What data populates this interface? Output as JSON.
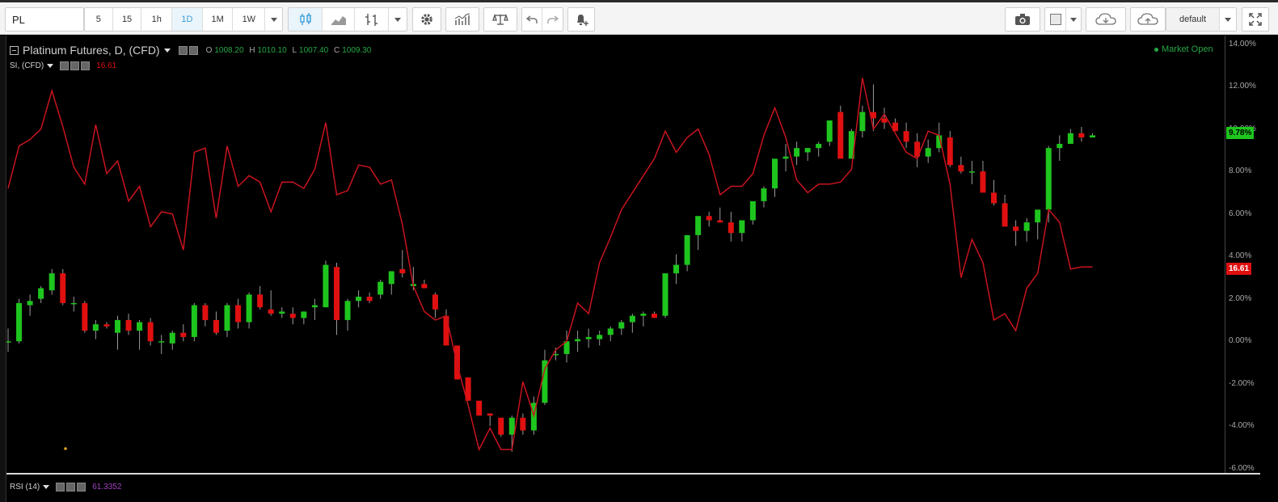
{
  "toolbar": {
    "symbol": "PL",
    "intervals": [
      "5",
      "15",
      "1h",
      "1D",
      "1M",
      "1W"
    ],
    "active_interval": "1D",
    "layout_name": "default",
    "colors": {
      "active": "#3aa0d8",
      "bg": "#f4f4f4"
    }
  },
  "legend": {
    "main_title": "Platinum Futures, D, (CFD)",
    "ohlc": [
      {
        "key": "O",
        "value": "1008.20"
      },
      {
        "key": "H",
        "value": "1010.10"
      },
      {
        "key": "L",
        "value": "1007.40"
      },
      {
        "key": "C",
        "value": "1009.30"
      }
    ],
    "compare_symbol": "SI, (CFD)",
    "compare_value": "16.61",
    "market_status": "Market Open"
  },
  "rsi": {
    "label": "RSI (14)",
    "value": "61.3352"
  },
  "axis": {
    "ticks": [
      "14.00%",
      "12.00%",
      "10.00%",
      "8.00%",
      "6.00%",
      "4.00%",
      "2.00%",
      "0.00%",
      "-2.00%",
      "-4.00%",
      "-6.00%"
    ],
    "tick_values": [
      14,
      12,
      10,
      8,
      6,
      4,
      2,
      0,
      -2,
      -4,
      -6
    ],
    "pl_badge": "9.78%",
    "pl_badge_value": 9.78,
    "si_badge": "16.61",
    "si_badge_value": 3.4
  },
  "chart_data": {
    "type": "candlestick",
    "ylim": [
      -6.2,
      14.4
    ],
    "y_unit": "%",
    "colors": {
      "up": "#1ec51e",
      "down": "#e01010",
      "compare": "#c8141e"
    },
    "series": [
      {
        "name": "PL",
        "kind": "ohlc_percent",
        "ohlc": [
          [
            0.0,
            0.6,
            -0.5,
            0.0
          ],
          [
            0.0,
            2.0,
            -0.1,
            1.8
          ],
          [
            1.7,
            2.2,
            1.2,
            1.9
          ],
          [
            2.0,
            2.6,
            1.8,
            2.5
          ],
          [
            2.4,
            3.4,
            2.2,
            3.2
          ],
          [
            3.2,
            3.4,
            1.7,
            1.8
          ],
          [
            1.8,
            2.1,
            1.4,
            1.8
          ],
          [
            1.8,
            1.9,
            0.4,
            0.5
          ],
          [
            0.5,
            1.0,
            0.1,
            0.8
          ],
          [
            0.8,
            0.9,
            0.6,
            0.7
          ],
          [
            0.4,
            1.2,
            -0.4,
            1.0
          ],
          [
            1.0,
            1.3,
            0.3,
            0.5
          ],
          [
            0.5,
            1.0,
            -0.4,
            0.9
          ],
          [
            0.9,
            1.1,
            -0.2,
            0.0
          ],
          [
            0.0,
            0.3,
            -0.6,
            0.0
          ],
          [
            -0.1,
            0.5,
            -0.4,
            0.4
          ],
          [
            0.4,
            0.8,
            0.0,
            0.2
          ],
          [
            0.2,
            1.8,
            0.0,
            1.7
          ],
          [
            1.7,
            1.8,
            0.7,
            1.0
          ],
          [
            1.0,
            1.4,
            0.3,
            0.4
          ],
          [
            0.5,
            1.8,
            0.2,
            1.7
          ],
          [
            1.7,
            2.0,
            0.6,
            0.9
          ],
          [
            0.9,
            2.3,
            0.6,
            2.2
          ],
          [
            2.2,
            2.6,
            1.5,
            1.6
          ],
          [
            1.5,
            2.4,
            1.2,
            1.3
          ],
          [
            1.3,
            1.6,
            1.1,
            1.4
          ],
          [
            1.3,
            1.6,
            0.8,
            1.1
          ],
          [
            1.1,
            1.4,
            0.8,
            1.4
          ],
          [
            1.6,
            2.0,
            1.0,
            1.7
          ],
          [
            1.6,
            3.8,
            1.6,
            3.6
          ],
          [
            3.5,
            3.7,
            0.3,
            1.0
          ],
          [
            1.0,
            2.0,
            0.5,
            1.9
          ],
          [
            1.9,
            2.4,
            1.6,
            2.1
          ],
          [
            2.1,
            2.3,
            1.8,
            1.9
          ],
          [
            2.2,
            2.9,
            2.0,
            2.8
          ],
          [
            2.7,
            3.1,
            2.2,
            3.3
          ],
          [
            3.4,
            4.3,
            3.0,
            3.2
          ],
          [
            2.6,
            3.5,
            2.4,
            2.7
          ],
          [
            2.7,
            2.9,
            2.5,
            2.5
          ],
          [
            2.2,
            2.3,
            1.1,
            1.5
          ],
          [
            1.2,
            1.5,
            -0.2,
            -0.2
          ],
          [
            -0.2,
            -0.3,
            -1.7,
            -1.8
          ],
          [
            -1.7,
            -2.0,
            -2.8,
            -2.8
          ],
          [
            -2.8,
            -3.3,
            -3.5,
            -3.5
          ],
          [
            -3.4,
            -3.5,
            -4.0,
            -3.5
          ],
          [
            -3.6,
            -4.1,
            -4.5,
            -4.4
          ],
          [
            -4.4,
            -3.5,
            -5.2,
            -3.6
          ],
          [
            -3.6,
            -3.4,
            -4.4,
            -4.2
          ],
          [
            -4.2,
            -2.6,
            -4.4,
            -2.9
          ],
          [
            -2.9,
            -0.4,
            -3.0,
            -0.9
          ],
          [
            -0.6,
            -0.3,
            -0.9,
            -0.6
          ],
          [
            -0.6,
            0.5,
            -1.0,
            0.0
          ],
          [
            0.0,
            0.5,
            -0.5,
            0.1
          ],
          [
            0.1,
            0.6,
            -0.3,
            0.2
          ],
          [
            0.1,
            0.5,
            -0.2,
            0.3
          ],
          [
            0.3,
            0.7,
            0.0,
            0.6
          ],
          [
            0.6,
            1.0,
            0.3,
            0.9
          ],
          [
            0.9,
            1.3,
            0.4,
            1.2
          ],
          [
            1.2,
            1.4,
            0.7,
            1.3
          ],
          [
            1.3,
            1.4,
            1.1,
            1.1
          ],
          [
            1.2,
            3.2,
            1.1,
            3.2
          ],
          [
            3.2,
            4.1,
            2.7,
            3.6
          ],
          [
            3.6,
            5.0,
            3.3,
            5.0
          ],
          [
            5.0,
            5.8,
            4.3,
            5.9
          ],
          [
            5.9,
            6.1,
            5.4,
            5.7
          ],
          [
            5.7,
            6.3,
            5.6,
            5.6
          ],
          [
            5.6,
            6.1,
            4.7,
            5.1
          ],
          [
            5.1,
            5.7,
            4.7,
            5.7
          ],
          [
            5.7,
            6.5,
            5.5,
            6.6
          ],
          [
            6.6,
            7.3,
            6.3,
            7.2
          ],
          [
            7.2,
            8.6,
            6.8,
            8.6
          ],
          [
            8.6,
            9.3,
            8.0,
            8.7
          ],
          [
            8.7,
            9.4,
            8.3,
            9.1
          ],
          [
            8.9,
            9.1,
            8.5,
            9.1
          ],
          [
            9.1,
            9.4,
            8.7,
            9.3
          ],
          [
            9.4,
            10.4,
            9.2,
            10.4
          ],
          [
            10.8,
            11.1,
            9.6,
            8.6
          ],
          [
            8.6,
            10.0,
            8.6,
            9.9
          ],
          [
            9.9,
            11.1,
            9.6,
            10.8
          ],
          [
            10.8,
            12.1,
            9.9,
            10.5
          ],
          [
            10.5,
            11.0,
            10.0,
            10.3
          ],
          [
            10.3,
            10.5,
            9.9,
            9.9
          ],
          [
            9.9,
            10.3,
            9.1,
            9.4
          ],
          [
            9.4,
            9.8,
            8.2,
            8.7
          ],
          [
            8.7,
            9.5,
            8.4,
            9.1
          ],
          [
            9.1,
            10.3,
            8.9,
            9.7
          ],
          [
            9.6,
            9.9,
            8.2,
            8.3
          ],
          [
            8.3,
            8.7,
            7.9,
            8.0
          ],
          [
            8.0,
            8.5,
            7.4,
            8.0
          ],
          [
            8.0,
            8.5,
            7.5,
            7.0
          ],
          [
            7.0,
            7.6,
            6.4,
            6.5
          ],
          [
            6.5,
            6.9,
            5.7,
            5.4
          ],
          [
            5.4,
            5.7,
            4.5,
            5.2
          ],
          [
            5.2,
            5.8,
            4.7,
            5.6
          ],
          [
            5.6,
            6.1,
            4.8,
            6.2
          ],
          [
            6.2,
            9.2,
            5.6,
            9.1
          ],
          [
            9.1,
            9.7,
            8.5,
            9.3
          ],
          [
            9.3,
            10.0,
            9.3,
            9.8
          ],
          [
            9.8,
            10.1,
            9.4,
            9.6
          ],
          [
            9.6,
            9.8,
            9.6,
            9.7
          ]
        ]
      },
      {
        "name": "SI",
        "kind": "line_percent",
        "values": [
          7.2,
          9.2,
          9.5,
          10.0,
          11.8,
          10.1,
          8.2,
          7.4,
          10.2,
          7.9,
          8.5,
          6.6,
          7.3,
          5.4,
          6.1,
          6.0,
          4.3,
          8.9,
          9.1,
          5.8,
          9.2,
          7.3,
          7.8,
          7.5,
          6.1,
          7.5,
          7.5,
          7.2,
          8.1,
          10.3,
          6.9,
          7.1,
          8.3,
          8.2,
          7.4,
          7.6,
          5.5,
          2.6,
          1.4,
          1.0,
          1.2,
          -1.1,
          -3.0,
          -5.1,
          -4.1,
          -5.1,
          -5.1,
          -1.9,
          -3.5,
          -1.3,
          -0.4,
          0.0,
          1.8,
          1.3,
          3.7,
          4.9,
          6.2,
          7.0,
          7.8,
          8.6,
          9.9,
          8.9,
          9.6,
          10.0,
          8.8,
          6.9,
          7.3,
          7.3,
          7.9,
          9.7,
          11.0,
          9.6,
          7.6,
          7.0,
          7.4,
          7.4,
          7.5,
          8.1,
          12.4,
          10.0,
          10.7,
          9.8,
          8.9,
          8.6,
          9.9,
          9.7,
          7.4,
          3.0,
          4.8,
          3.7,
          1.0,
          1.3,
          0.5,
          2.5,
          3.2,
          6.2,
          5.6,
          3.4,
          3.5,
          3.5
        ]
      }
    ]
  }
}
